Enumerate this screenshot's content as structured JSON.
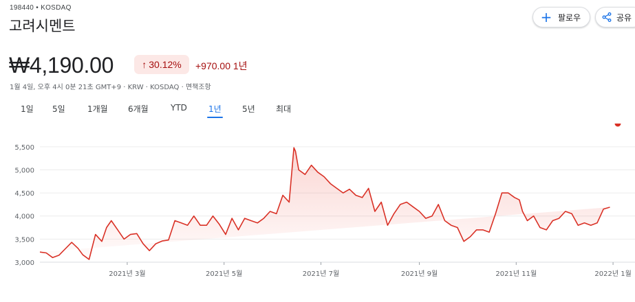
{
  "header": {
    "ticker": "198440 • KOSDAQ",
    "company_name": "고려시멘트",
    "follow_label": "팔로우",
    "follow_icon": "plus-icon",
    "share_label": "공유",
    "share_icon": "share-icon"
  },
  "quote": {
    "price": "₩4,190.00",
    "change_percent": "30.12%",
    "change_icon": "arrow-up-icon",
    "change_amount": "+970.00",
    "change_period": "1년",
    "meta": "1월 4일, 오후 4시 0분 21초 GMT+9 · KRW · KOSDAQ · 면책조항",
    "negative_color": "#a50e0e",
    "badge_bg": "#fce8e6"
  },
  "range_tabs": [
    "1일",
    "5일",
    "1개월",
    "6개월",
    "YTD",
    "1년",
    "5년",
    "최대"
  ],
  "active_tab": "1년",
  "chart_data": {
    "type": "area",
    "title": "",
    "xlabel": "",
    "ylabel": "",
    "ylim": [
      3000,
      5750
    ],
    "yticks": [
      3000,
      3500,
      4000,
      4500,
      5000,
      5500
    ],
    "ytick_labels": [
      "3,000",
      "3,500",
      "4,000",
      "4,500",
      "5,000",
      "5,500"
    ],
    "xrange": [
      "2021-01-05",
      "2022-01-04"
    ],
    "xtick_labels": [
      {
        "date": "2021-03-01",
        "label": "2021년 3월"
      },
      {
        "date": "2021-05-01",
        "label": "2021년 5월"
      },
      {
        "date": "2021-07-01",
        "label": "2021년 7월"
      },
      {
        "date": "2021-09-01",
        "label": "2021년 9월"
      },
      {
        "date": "2021-11-01",
        "label": "2021년 11월"
      },
      {
        "date": "2022-01-01",
        "label": "2022년 1월"
      }
    ],
    "grid": true,
    "line_color": "#d93025",
    "x": [
      "2021-01-05",
      "2021-01-09",
      "2021-01-13",
      "2021-01-17",
      "2021-01-21",
      "2021-01-25",
      "2021-01-29",
      "2021-02-01",
      "2021-02-05",
      "2021-02-09",
      "2021-02-13",
      "2021-02-16",
      "2021-02-19",
      "2021-02-23",
      "2021-02-27",
      "2021-03-03",
      "2021-03-07",
      "2021-03-11",
      "2021-03-15",
      "2021-03-19",
      "2021-03-23",
      "2021-03-27",
      "2021-03-31",
      "2021-04-04",
      "2021-04-08",
      "2021-04-12",
      "2021-04-16",
      "2021-04-20",
      "2021-04-24",
      "2021-04-28",
      "2021-05-02",
      "2021-05-06",
      "2021-05-10",
      "2021-05-14",
      "2021-05-18",
      "2021-05-22",
      "2021-05-26",
      "2021-05-30",
      "2021-06-03",
      "2021-06-07",
      "2021-06-11",
      "2021-06-14",
      "2021-06-15",
      "2021-06-17",
      "2021-06-21",
      "2021-06-25",
      "2021-06-29",
      "2021-07-03",
      "2021-07-07",
      "2021-07-11",
      "2021-07-15",
      "2021-07-19",
      "2021-07-23",
      "2021-07-27",
      "2021-07-31",
      "2021-08-04",
      "2021-08-08",
      "2021-08-12",
      "2021-08-16",
      "2021-08-20",
      "2021-08-24",
      "2021-08-28",
      "2021-09-01",
      "2021-09-05",
      "2021-09-09",
      "2021-09-13",
      "2021-09-17",
      "2021-09-21",
      "2021-09-25",
      "2021-09-29",
      "2021-10-03",
      "2021-10-07",
      "2021-10-11",
      "2021-10-15",
      "2021-10-19",
      "2021-10-23",
      "2021-10-27",
      "2021-10-31",
      "2021-11-03",
      "2021-11-05",
      "2021-11-08",
      "2021-11-12",
      "2021-11-16",
      "2021-11-20",
      "2021-11-24",
      "2021-11-28",
      "2021-12-02",
      "2021-12-06",
      "2021-12-10",
      "2021-12-14",
      "2021-12-18",
      "2021-12-22",
      "2021-12-26",
      "2021-12-30",
      "2022-01-04"
    ],
    "y": [
      3220,
      3200,
      3100,
      3150,
      3290,
      3430,
      3300,
      3160,
      3060,
      3600,
      3450,
      3750,
      3900,
      3700,
      3500,
      3600,
      3620,
      3400,
      3250,
      3400,
      3460,
      3480,
      3900,
      3850,
      3800,
      4000,
      3800,
      3800,
      4000,
      3820,
      3600,
      3950,
      3700,
      3950,
      3900,
      3850,
      3950,
      4100,
      4050,
      4450,
      4300,
      5480,
      5400,
      5000,
      4900,
      5100,
      4950,
      4850,
      4700,
      4600,
      4500,
      4580,
      4450,
      4400,
      4600,
      4100,
      4300,
      3800,
      4050,
      4250,
      4300,
      4200,
      4100,
      3950,
      4000,
      4250,
      3900,
      3800,
      3750,
      3450,
      3550,
      3700,
      3700,
      3650,
      4050,
      4500,
      4500,
      4400,
      4350,
      4100,
      3900,
      4000,
      3750,
      3700,
      3900,
      3950,
      4100,
      4050,
      3800,
      3850,
      3800,
      3850,
      4150,
      4190
    ]
  }
}
